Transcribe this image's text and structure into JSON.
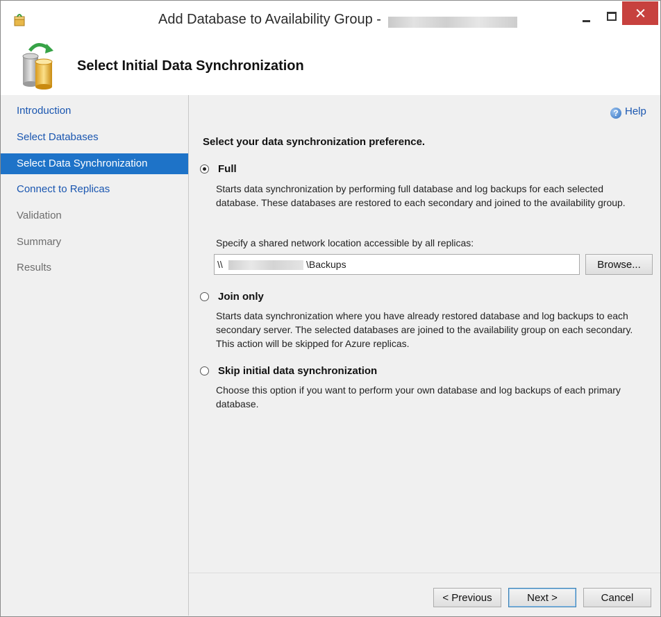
{
  "window": {
    "title": "Add Database to Availability Group -"
  },
  "header": {
    "title": "Select Initial Data Synchronization"
  },
  "sidebar": {
    "items": [
      {
        "label": "Introduction",
        "state": "link"
      },
      {
        "label": "Select Databases",
        "state": "link"
      },
      {
        "label": "Select Data Synchronization",
        "state": "selected"
      },
      {
        "label": "Connect to Replicas",
        "state": "link"
      },
      {
        "label": "Validation",
        "state": "disabled"
      },
      {
        "label": "Summary",
        "state": "disabled"
      },
      {
        "label": "Results",
        "state": "disabled"
      }
    ]
  },
  "main": {
    "help_label": "Help",
    "prompt": "Select your data synchronization preference.",
    "options": [
      {
        "label": "Full",
        "selected": true,
        "description": "Starts data synchronization by performing full database and log backups for each selected database. These databases are restored to each secondary and joined to the availability group."
      },
      {
        "label": "Join only",
        "selected": false,
        "description": "Starts data synchronization where you have already restored database and log backups to each secondary server. The selected databases are joined to the availability group on each secondary. This action will be skipped for Azure replicas."
      },
      {
        "label": "Skip initial data synchronization",
        "selected": false,
        "description": "Choose this option if you want to perform your own database and log backups of each primary database."
      }
    ],
    "location_label": "Specify a shared network location accessible by all replicas:",
    "location_prefix": "\\\\",
    "location_suffix": "\\Backups",
    "browse_label": "Browse..."
  },
  "footer": {
    "previous_label": "< Previous",
    "next_label": "Next >",
    "cancel_label": "Cancel"
  },
  "colors": {
    "selected_nav": "#1e73c8",
    "link": "#1a56b0",
    "close_button": "#c7413e"
  }
}
